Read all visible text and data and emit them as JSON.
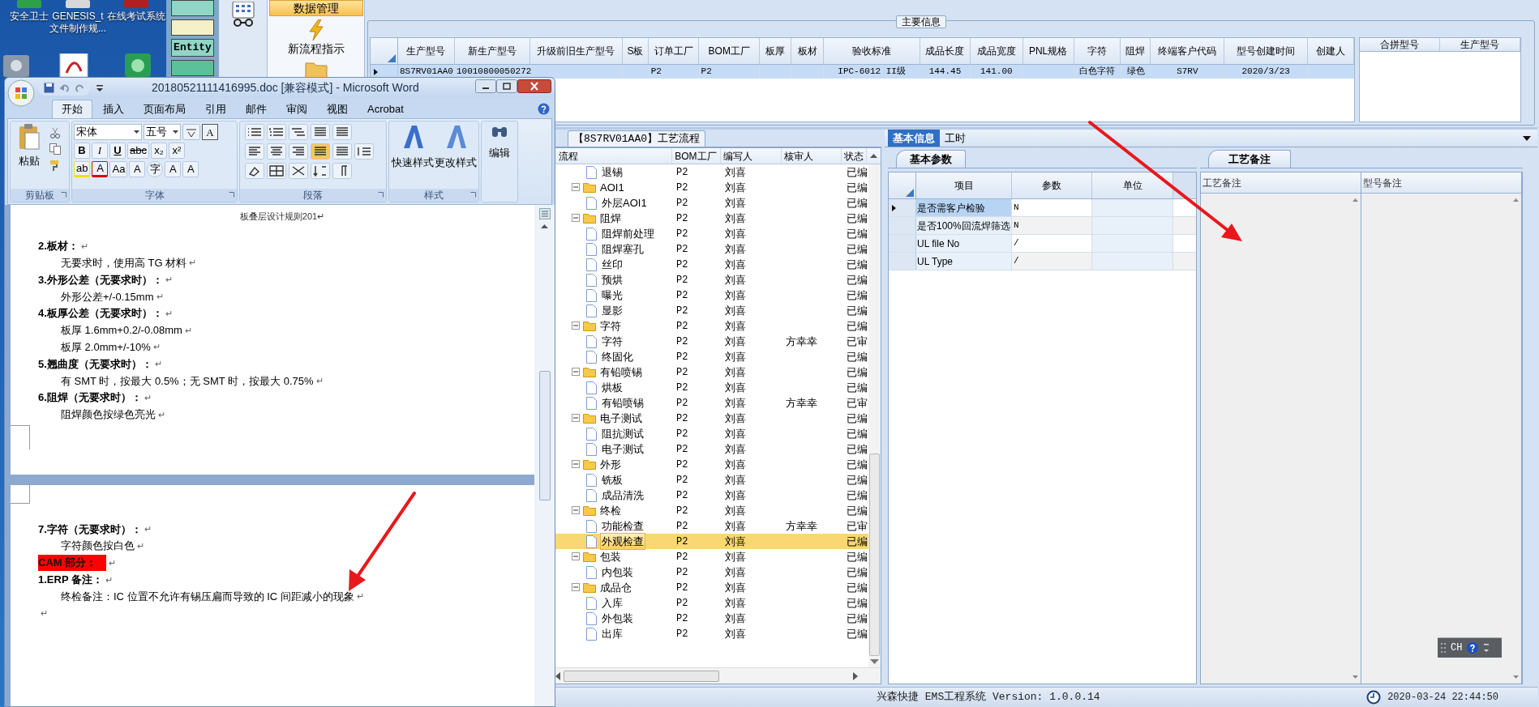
{
  "desktop": {
    "icons": [
      {
        "label_lines": [
          "安全卫士"
        ]
      },
      {
        "label_lines": [
          "GENESIS_t",
          "文件制作规..."
        ]
      },
      {
        "label_lines": [
          "在线考试系统"
        ]
      }
    ]
  },
  "side_app": {
    "label": "Entity"
  },
  "ems": {
    "nav": [
      {
        "label": "数据管理",
        "selected": true
      },
      {
        "label": "新流程指示",
        "selected": false
      }
    ],
    "main_info": {
      "title": "主要信息",
      "columns": [
        "生产型号",
        "新生产型号",
        "升级前旧生产型号",
        "S板",
        "订单工厂",
        "BOM工厂",
        "板厚",
        "板材",
        "验收标准",
        "成品长度",
        "成品宽度",
        "PNL规格",
        "字符",
        "阻焊",
        "终端客户代码",
        "型号创建时间",
        "创建人"
      ],
      "rows": [
        {
          "selected": true,
          "cells": [
            "8S7RV01AA0",
            "10010800050272",
            null,
            null,
            "P2",
            "P2",
            null,
            null,
            "IPC-6012 II级",
            "144.45",
            "141.00",
            null,
            "白色字符",
            "绿色",
            "S7RV",
            "2020/3/23",
            null
          ]
        }
      ],
      "side_columns": [
        "合拼型号",
        "生产型号"
      ]
    },
    "process": {
      "tab": "【8S7RV01AA0】工艺流程",
      "columns": [
        "流程",
        "BOM工厂",
        "编写人",
        "核审人",
        "状态"
      ],
      "items": [
        {
          "kind": "step",
          "label": "退锡",
          "bom": "P2",
          "writer": "刘喜",
          "status": "已编",
          "selected": false
        },
        {
          "kind": "group",
          "label": "AOI1",
          "bom": "P2",
          "writer": "刘喜",
          "status": "已编",
          "selected": false,
          "expanded": true,
          "children": [
            {
              "kind": "step",
              "label": "外层AOI1",
              "bom": "P2",
              "writer": "刘喜",
              "status": "已编",
              "selected": false
            }
          ]
        },
        {
          "kind": "group",
          "label": "阻焊",
          "bom": "P2",
          "writer": "刘喜",
          "status": "已编",
          "selected": false,
          "expanded": true,
          "children": [
            {
              "kind": "step",
              "label": "阻焊前处理",
              "bom": "P2",
              "writer": "刘喜",
              "status": "已编",
              "selected": false
            },
            {
              "kind": "step",
              "label": "阻焊塞孔",
              "bom": "P2",
              "writer": "刘喜",
              "status": "已编",
              "selected": false
            },
            {
              "kind": "step",
              "label": "丝印",
              "bom": "P2",
              "writer": "刘喜",
              "status": "已编",
              "selected": false
            },
            {
              "kind": "step",
              "label": "预烘",
              "bom": "P2",
              "writer": "刘喜",
              "status": "已编",
              "selected": false
            },
            {
              "kind": "step",
              "label": "曝光",
              "bom": "P2",
              "writer": "刘喜",
              "status": "已编",
              "selected": false
            },
            {
              "kind": "step",
              "label": "显影",
              "bom": "P2",
              "writer": "刘喜",
              "status": "已编",
              "selected": false
            }
          ]
        },
        {
          "kind": "group",
          "label": "字符",
          "bom": "P2",
          "writer": "刘喜",
          "status": "已编",
          "selected": false,
          "expanded": true,
          "children": [
            {
              "kind": "step",
              "label": "字符",
              "bom": "P2",
              "writer": "刘喜",
              "reviewer": "方幸幸",
              "status": "已审",
              "selected": false
            },
            {
              "kind": "step",
              "label": "终固化",
              "bom": "P2",
              "writer": "刘喜",
              "status": "已编",
              "selected": false
            }
          ]
        },
        {
          "kind": "group",
          "label": "有铅喷锡",
          "bom": "P2",
          "writer": "刘喜",
          "status": "已编",
          "selected": false,
          "expanded": true,
          "children": [
            {
              "kind": "step",
              "label": "烘板",
              "bom": "P2",
              "writer": "刘喜",
              "status": "已编",
              "selected": false
            },
            {
              "kind": "step",
              "label": "有铅喷锡",
              "bom": "P2",
              "writer": "刘喜",
              "reviewer": "方幸幸",
              "status": "已审",
              "selected": false
            }
          ]
        },
        {
          "kind": "group",
          "label": "电子测试",
          "bom": "P2",
          "writer": "刘喜",
          "status": "已编",
          "selected": false,
          "expanded": true,
          "children": [
            {
              "kind": "step",
              "label": "阻抗测试",
              "bom": "P2",
              "writer": "刘喜",
              "status": "已编",
              "selected": false
            },
            {
              "kind": "step",
              "label": "电子测试",
              "bom": "P2",
              "writer": "刘喜",
              "status": "已编",
              "selected": false
            }
          ]
        },
        {
          "kind": "group",
          "label": "外形",
          "bom": "P2",
          "writer": "刘喜",
          "status": "已编",
          "selected": false,
          "expanded": true,
          "children": [
            {
              "kind": "step",
              "label": "铣板",
              "bom": "P2",
              "writer": "刘喜",
              "status": "已编",
              "selected": false
            },
            {
              "kind": "step",
              "label": "成品清洗",
              "bom": "P2",
              "writer": "刘喜",
              "status": "已编",
              "selected": false
            }
          ]
        },
        {
          "kind": "group",
          "label": "终检",
          "bom": "P2",
          "writer": "刘喜",
          "status": "已编",
          "selected": false,
          "expanded": true,
          "children": [
            {
              "kind": "step",
              "label": "功能检查",
              "bom": "P2",
              "writer": "刘喜",
              "reviewer": "方幸幸",
              "status": "已审",
              "selected": false
            },
            {
              "kind": "step",
              "label": "外观检查",
              "bom": "P2",
              "writer": "刘喜",
              "status": "已编",
              "selected": true
            }
          ]
        },
        {
          "kind": "group",
          "label": "包装",
          "bom": "P2",
          "writer": "刘喜",
          "status": "已编",
          "selected": false,
          "expanded": true,
          "children": [
            {
              "kind": "step",
              "label": "内包装",
              "bom": "P2",
              "writer": "刘喜",
              "status": "已编",
              "selected": false
            }
          ]
        },
        {
          "kind": "group",
          "label": "成品仓",
          "bom": "P2",
          "writer": "刘喜",
          "status": "已编",
          "selected": false,
          "expanded": true,
          "children": [
            {
              "kind": "step",
              "label": "入库",
              "bom": "P2",
              "writer": "刘喜",
              "status": "已编",
              "selected": false
            },
            {
              "kind": "step",
              "label": "外包装",
              "bom": "P2",
              "writer": "刘喜",
              "status": "已编",
              "selected": false
            },
            {
              "kind": "step",
              "label": "出库",
              "bom": "P2",
              "writer": "刘喜",
              "status": "已编",
              "selected": false
            }
          ]
        }
      ]
    },
    "detail_tabs": [
      {
        "label": "基本信息",
        "selected": true
      },
      {
        "label": "工时",
        "selected": false
      }
    ],
    "params": {
      "tab": "基本参数",
      "columns": [
        "项目",
        "参数",
        "单位"
      ],
      "rows": [
        {
          "item": "是否需客户检验",
          "value": "N",
          "selected": true
        },
        {
          "item": "是否100%回流焊筛选",
          "value": "N",
          "selected": false
        },
        {
          "item": "UL file No",
          "value": "/",
          "selected": false
        },
        {
          "item": "UL Type",
          "value": "/",
          "selected": false
        }
      ]
    },
    "remarks": {
      "tab": "工艺备注",
      "columns": [
        "工艺备注",
        "型号备注"
      ]
    },
    "language_bar": {
      "label": "CH"
    },
    "status_bar": {
      "title": "兴森快捷 EMS工程系统 Version: 1.0.0.14",
      "datetime": "2020-03-24 22:44:50"
    }
  },
  "word": {
    "title": "20180521111416995.doc [兼容模式] - Microsoft Word",
    "tabs": [
      {
        "label": "开始",
        "selected": true
      },
      {
        "label": "插入",
        "selected": false
      },
      {
        "label": "页面布局",
        "selected": false
      },
      {
        "label": "引用",
        "selected": false
      },
      {
        "label": "邮件",
        "selected": false
      },
      {
        "label": "审阅",
        "selected": false
      },
      {
        "label": "视图",
        "selected": false
      },
      {
        "label": "Acrobat",
        "selected": false
      }
    ],
    "ribbon": {
      "paste": "粘贴",
      "font": "宋体",
      "size": "五号",
      "font_row_1": [
        {
          "text": "B",
          "kind": "bold"
        },
        {
          "text": "I",
          "kind": "italic"
        },
        {
          "text": "U",
          "kind": "underline"
        },
        {
          "text": "abc",
          "kind": "strike"
        },
        {
          "text": "x₂",
          "kind": "plain"
        },
        {
          "text": "x²",
          "kind": "plain"
        }
      ],
      "font_row_2": [
        {
          "text": "ab",
          "kind": "highlight"
        },
        {
          "text": "A",
          "kind": "font-color"
        },
        {
          "text": "Aa",
          "kind": "plain"
        },
        {
          "text": "A",
          "kind": "shaded"
        },
        {
          "text": "字",
          "kind": "circled"
        },
        {
          "text": "A",
          "kind": "plain"
        },
        {
          "text": "A",
          "kind": "small"
        }
      ],
      "boxed": "A",
      "quick_styles": "快速样式",
      "change_styles": "更改样式",
      "edit": "编辑",
      "groups": [
        "剪贴板",
        "字体",
        "段落",
        "样式"
      ]
    },
    "pages": [
      {
        "header": "板叠层设计规则201↵",
        "lines": [
          {
            "kind": "heading",
            "text": "2.板材：",
            "mark": "↵"
          },
          {
            "kind": "body",
            "text": "无要求时，使用高 TG 材料",
            "mark": "↵"
          },
          {
            "kind": "heading",
            "text": "3.外形公差（无要求时）：",
            "mark": "↵"
          },
          {
            "kind": "body",
            "text": "外形公差+/-0.15mm",
            "mark": "↵"
          },
          {
            "kind": "heading",
            "text": "4.板厚公差（无要求时）：",
            "mark": "↵"
          },
          {
            "kind": "body",
            "text": "板厚 1.6mm+0.2/-0.08mm",
            "mark": "↵"
          },
          {
            "kind": "body",
            "text": "板厚 2.0mm+/-10%",
            "mark": "↵"
          },
          {
            "kind": "heading",
            "text": "5.翘曲度（无要求时）：",
            "mark": "↵"
          },
          {
            "kind": "body",
            "text": "有 SMT 时，按最大 0.5%；无 SMT 时，按最大 0.75%",
            "mark": "↵"
          },
          {
            "kind": "heading",
            "text": "6.阻焊（无要求时）：",
            "mark": "↵"
          },
          {
            "kind": "body",
            "text": "阻焊颜色按绿色亮光",
            "mark": "↵"
          }
        ]
      },
      {
        "lines": [
          {
            "kind": "heading",
            "text": "7.字符（无要求时）：",
            "mark": "↵"
          },
          {
            "kind": "body",
            "text": "字符颜色按白色",
            "mark": "↵"
          },
          {
            "kind": "highlight",
            "text": "CAM 部分：",
            "mark": "↵"
          },
          {
            "kind": "heading",
            "text": "1.ERP 备注：",
            "mark": "↵"
          },
          {
            "kind": "body",
            "text": "终检备注：IC 位置不允许有锡压扁而导致的 IC 间距减小的现象",
            "mark": "↵"
          },
          {
            "kind": "empty",
            "mark": "↵"
          }
        ]
      }
    ]
  }
}
